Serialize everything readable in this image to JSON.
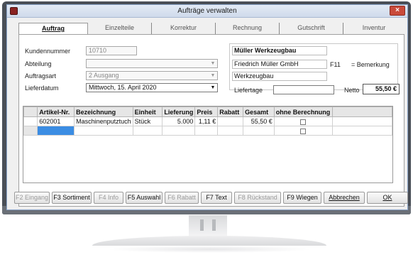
{
  "window": {
    "title": "Aufträge verwalten",
    "close_label": "×"
  },
  "tabs": [
    {
      "label": "Auftrag",
      "active": true
    },
    {
      "label": "Einzelteile"
    },
    {
      "label": "Korrektur"
    },
    {
      "label": "Rechnung"
    },
    {
      "label": "Gutschrift"
    },
    {
      "label": "Inventur"
    }
  ],
  "form": {
    "kundennummer_label": "Kundennummer",
    "kundennummer_value": "10710",
    "abteilung_label": "Abteilung",
    "abteilung_value": "",
    "auftragsart_label": "Auftragsart",
    "auftragsart_value": "2  Ausgang",
    "lieferdatum_label": "Lieferdatum",
    "lieferdatum_value": "Mittwoch, 15. April 2020"
  },
  "customer": {
    "name": "Müller Werkzeugbau",
    "line2": "Friedrich Müller GmbH",
    "line3": "Werkzeugbau",
    "f11_label": "F11",
    "bemerkung_label": "= Bemerkung",
    "liefertage_label": "Liefertage",
    "netto_label": "Netto",
    "netto_value": "55,50 €"
  },
  "grid": {
    "columns": [
      "Artikel-Nr.",
      "Bezeichnung",
      "Einheit",
      "Lieferung",
      "Preis",
      "Rabatt",
      "Gesamt",
      "ohne Berechnung"
    ],
    "rows": [
      {
        "artikel": "602001",
        "bezeichnung": "Maschinenputztuch",
        "einheit": "Stück",
        "lieferung": "5.000",
        "preis": "1,11 €",
        "rabatt": "",
        "gesamt": "55,50 €",
        "ohne_berechnung": false
      }
    ]
  },
  "function_keys": [
    {
      "label": "F2 Eingang",
      "enabled": false
    },
    {
      "label": "F3 Sortiment",
      "enabled": true
    },
    {
      "label": "F4 Info",
      "enabled": false
    },
    {
      "label": "F5 Auswahl",
      "enabled": true
    },
    {
      "label": "F6 Rabatt",
      "enabled": false
    },
    {
      "label": "F7 Text",
      "enabled": true
    },
    {
      "label": "F8 Rückstand",
      "enabled": false
    },
    {
      "label": "F9 Wiegen",
      "enabled": true
    },
    {
      "label": "Abbrechen",
      "enabled": true
    },
    {
      "label": "OK",
      "enabled": true
    }
  ]
}
